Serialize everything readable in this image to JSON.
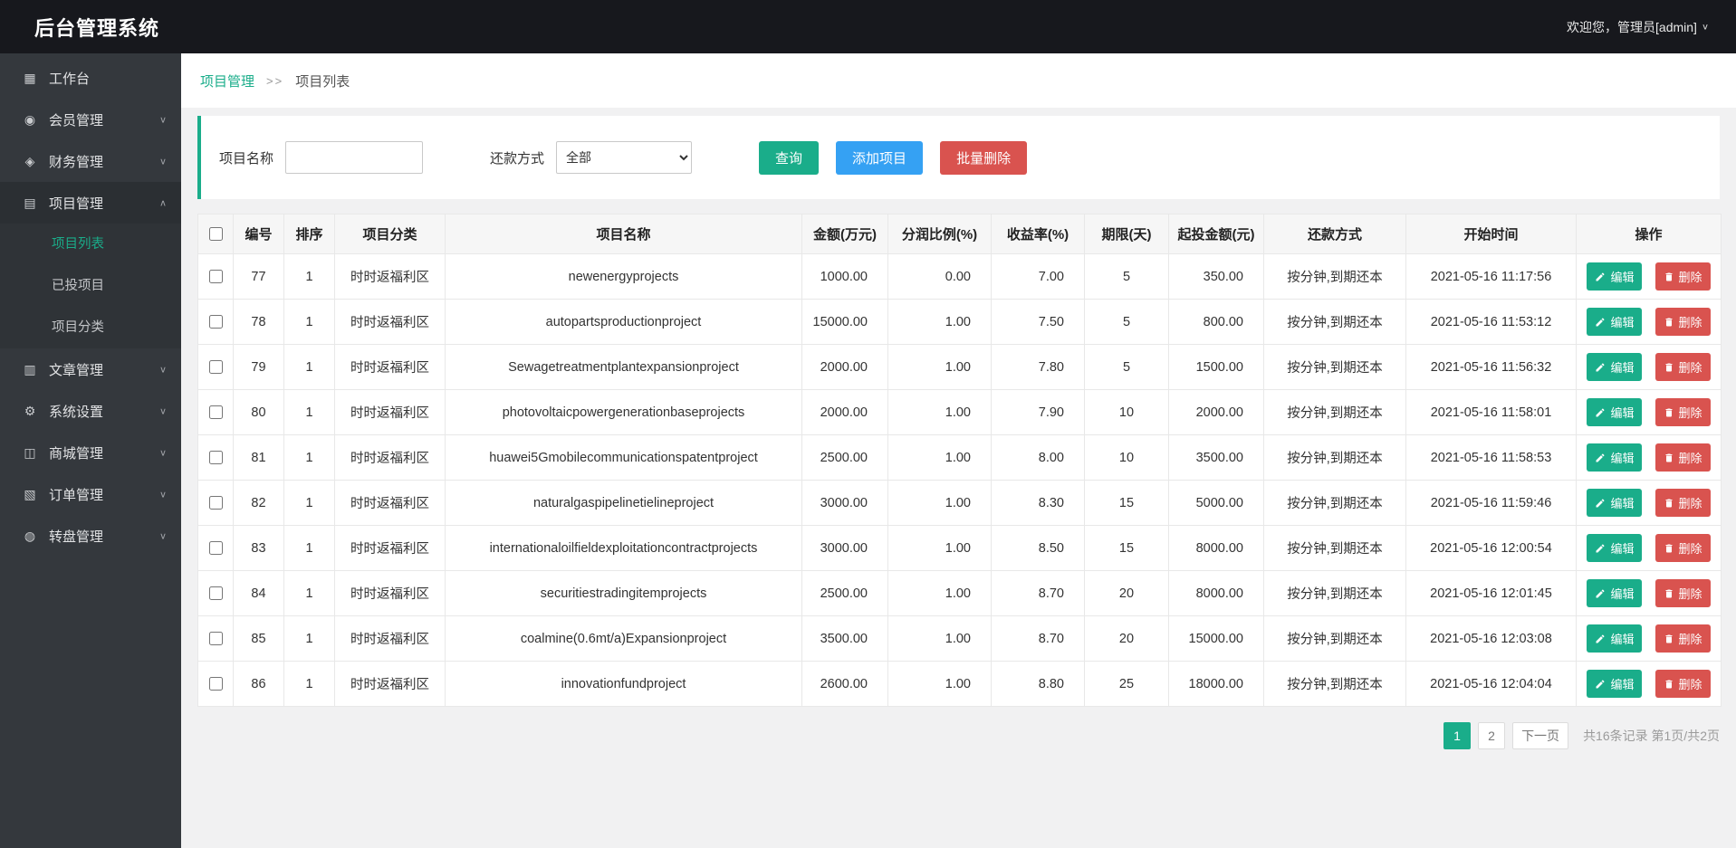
{
  "colors": {
    "accent_teal": "#1aad8a",
    "accent_blue": "#35a1f3",
    "accent_red": "#d9534f",
    "topbar_bg": "#17181d",
    "sidebar_bg": "#34383d"
  },
  "topbar": {
    "title": "后台管理系统",
    "welcome": "欢迎您，管理员[admin]",
    "welcome_chevron": "∨"
  },
  "sidebar": {
    "items": [
      {
        "id": "workbench",
        "icon": "workbench-icon",
        "glyph": "▦",
        "label": "工作台",
        "chevron": ""
      },
      {
        "id": "members",
        "icon": "member-icon",
        "glyph": "◉",
        "label": "会员管理",
        "chevron": "∨"
      },
      {
        "id": "finance",
        "icon": "finance-icon",
        "glyph": "◈",
        "label": "财务管理",
        "chevron": "∨"
      },
      {
        "id": "projects",
        "icon": "project-icon",
        "glyph": "▤",
        "label": "项目管理",
        "chevron": "∧",
        "expanded": true,
        "children": [
          {
            "id": "project-list",
            "label": "项目列表",
            "active": true
          },
          {
            "id": "invested-projects",
            "label": "已投项目",
            "active": false
          },
          {
            "id": "project-categories",
            "label": "项目分类",
            "active": false
          }
        ]
      },
      {
        "id": "articles",
        "icon": "article-icon",
        "glyph": "▥",
        "label": "文章管理",
        "chevron": "∨"
      },
      {
        "id": "settings",
        "icon": "gear-icon",
        "glyph": "⚙",
        "label": "系统设置",
        "chevron": "∨"
      },
      {
        "id": "mall",
        "icon": "mall-icon",
        "glyph": "◫",
        "label": "商城管理",
        "chevron": "∨"
      },
      {
        "id": "orders",
        "icon": "order-icon",
        "glyph": "▧",
        "label": "订单管理",
        "chevron": "∨"
      },
      {
        "id": "turntable",
        "icon": "turntable-icon",
        "glyph": "◍",
        "label": "转盘管理",
        "chevron": "∨"
      }
    ]
  },
  "breadcrumb": {
    "parent": "项目管理",
    "separator": ">>",
    "current": "项目列表"
  },
  "filters": {
    "name_label": "项目名称",
    "name_value": "",
    "repay_label": "还款方式",
    "repay_selected": "全部",
    "search_button": "查询",
    "add_button": "添加项目",
    "batch_delete_button": "批量删除"
  },
  "table": {
    "columns": [
      "编号",
      "排序",
      "项目分类",
      "项目名称",
      "金额(万元)",
      "分润比例(%)",
      "收益率(%)",
      "期限(天)",
      "起投金额(元)",
      "还款方式",
      "开始时间",
      "操作"
    ],
    "edit_label": "编辑",
    "delete_label": "删除",
    "rows": [
      {
        "id": "77",
        "sort": "1",
        "category": "时时返福利区",
        "name": "newenergyprojects",
        "amount": "1000.00",
        "share": "0.00",
        "rate": "7.00",
        "days": "5",
        "min": "350.00",
        "repay": "按分钟,到期还本",
        "start": "2021-05-16 11:17:56"
      },
      {
        "id": "78",
        "sort": "1",
        "category": "时时返福利区",
        "name": "autopartsproductionproject",
        "amount": "15000.00",
        "share": "1.00",
        "rate": "7.50",
        "days": "5",
        "min": "800.00",
        "repay": "按分钟,到期还本",
        "start": "2021-05-16 11:53:12"
      },
      {
        "id": "79",
        "sort": "1",
        "category": "时时返福利区",
        "name": "Sewagetreatmentplantexpansionproject",
        "amount": "2000.00",
        "share": "1.00",
        "rate": "7.80",
        "days": "5",
        "min": "1500.00",
        "repay": "按分钟,到期还本",
        "start": "2021-05-16 11:56:32"
      },
      {
        "id": "80",
        "sort": "1",
        "category": "时时返福利区",
        "name": "photovoltaicpowergenerationbaseprojects",
        "amount": "2000.00",
        "share": "1.00",
        "rate": "7.90",
        "days": "10",
        "min": "2000.00",
        "repay": "按分钟,到期还本",
        "start": "2021-05-16 11:58:01"
      },
      {
        "id": "81",
        "sort": "1",
        "category": "时时返福利区",
        "name": "huawei5Gmobilecommunicationspatentproject",
        "amount": "2500.00",
        "share": "1.00",
        "rate": "8.00",
        "days": "10",
        "min": "3500.00",
        "repay": "按分钟,到期还本",
        "start": "2021-05-16 11:58:53"
      },
      {
        "id": "82",
        "sort": "1",
        "category": "时时返福利区",
        "name": "naturalgaspipelinetielineproject",
        "amount": "3000.00",
        "share": "1.00",
        "rate": "8.30",
        "days": "15",
        "min": "5000.00",
        "repay": "按分钟,到期还本",
        "start": "2021-05-16 11:59:46"
      },
      {
        "id": "83",
        "sort": "1",
        "category": "时时返福利区",
        "name": "internationaloilfieldexploitationcontractprojects",
        "amount": "3000.00",
        "share": "1.00",
        "rate": "8.50",
        "days": "15",
        "min": "8000.00",
        "repay": "按分钟,到期还本",
        "start": "2021-05-16 12:00:54"
      },
      {
        "id": "84",
        "sort": "1",
        "category": "时时返福利区",
        "name": "securitiestradingitemprojects",
        "amount": "2500.00",
        "share": "1.00",
        "rate": "8.70",
        "days": "20",
        "min": "8000.00",
        "repay": "按分钟,到期还本",
        "start": "2021-05-16 12:01:45"
      },
      {
        "id": "85",
        "sort": "1",
        "category": "时时返福利区",
        "name": "coalmine(0.6mt/a)Expansionproject",
        "amount": "3500.00",
        "share": "1.00",
        "rate": "8.70",
        "days": "20",
        "min": "15000.00",
        "repay": "按分钟,到期还本",
        "start": "2021-05-16 12:03:08"
      },
      {
        "id": "86",
        "sort": "1",
        "category": "时时返福利区",
        "name": "innovationfundproject",
        "amount": "2600.00",
        "share": "1.00",
        "rate": "8.80",
        "days": "25",
        "min": "18000.00",
        "repay": "按分钟,到期还本",
        "start": "2021-05-16 12:04:04"
      }
    ]
  },
  "pagination": {
    "page1": "1",
    "page2": "2",
    "next": "下一页",
    "summary": "共16条记录 第1页/共2页"
  }
}
